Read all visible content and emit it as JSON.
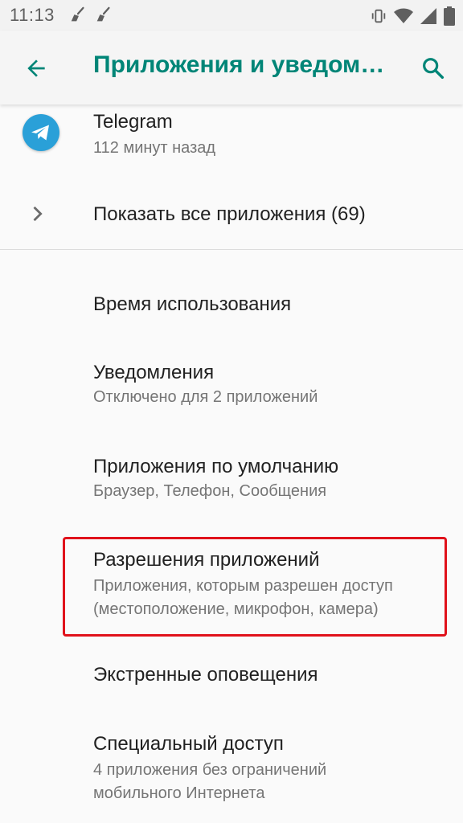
{
  "status_bar": {
    "time": "11:13",
    "left_icons": [
      "broom-icon",
      "broom-icon"
    ],
    "right_icons": [
      "vibrate-icon",
      "wifi-icon",
      "signal-icon",
      "battery-icon"
    ]
  },
  "app_bar": {
    "title": "Приложения и уведом…",
    "accent_color": "#008577"
  },
  "recent_apps": [
    {
      "name": "Telegram",
      "subtitle": "112 минут назад",
      "icon": "telegram-icon"
    }
  ],
  "show_all": {
    "label": "Показать все приложения (69)",
    "icon": "chevron-right-icon"
  },
  "settings": [
    {
      "title": "Время использования"
    },
    {
      "title": "Уведомления",
      "subtitle": "Отключено для 2 приложений"
    },
    {
      "title": "Приложения по умолчанию",
      "subtitle": "Браузер, Телефон, Сообщения"
    },
    {
      "title": "Разрешения приложений",
      "subtitle_lines": [
        "Приложения, которым разрешен доступ",
        "(местоположение, микрофон, камера)"
      ],
      "highlighted": true
    },
    {
      "title": "Экстренные оповещения"
    },
    {
      "title": "Специальный доступ",
      "subtitle_lines": [
        "4 приложения без ограничений",
        "мобильного Интернета"
      ]
    }
  ],
  "highlight_color": "#e0121b"
}
